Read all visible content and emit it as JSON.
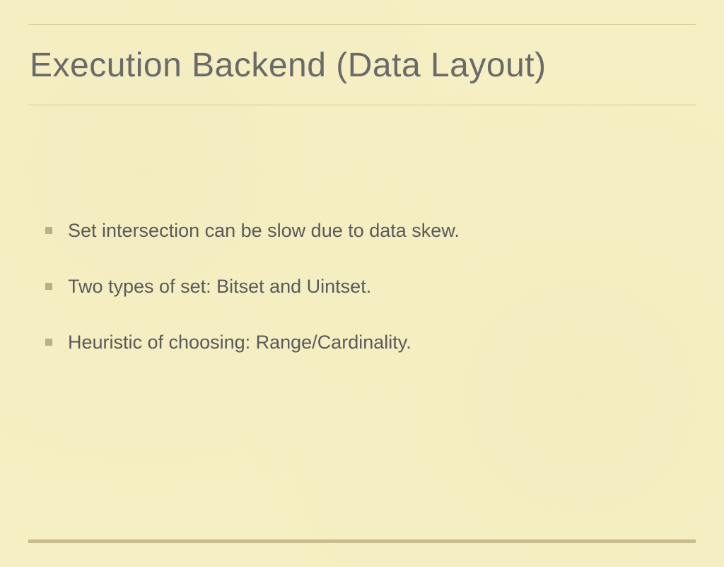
{
  "slide": {
    "title": "Execution Backend (Data Layout)",
    "bullets": [
      "Set intersection can be slow due to data skew.",
      "Two types of set: Bitset and Uintset.",
      "Heuristic of choosing: Range/Cardinality."
    ]
  }
}
